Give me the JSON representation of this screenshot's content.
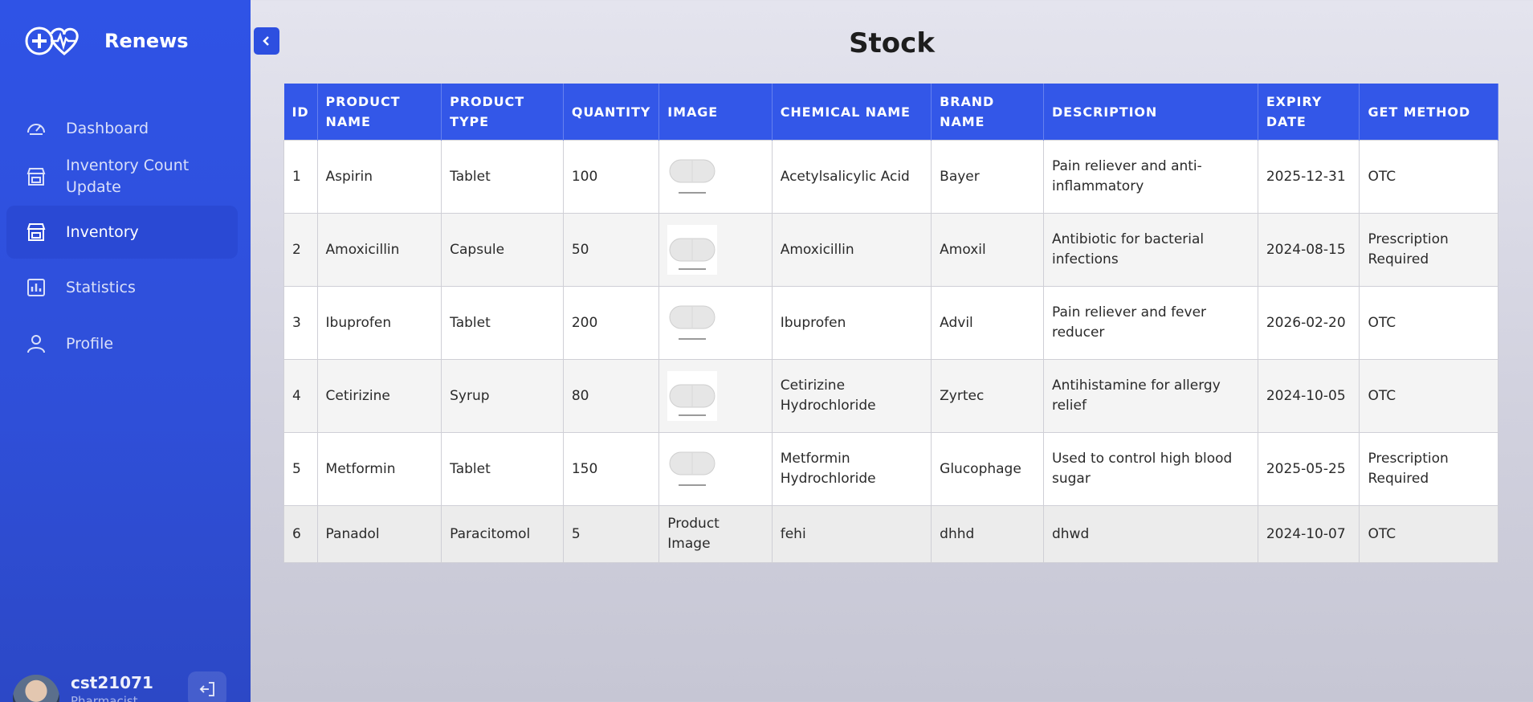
{
  "app": {
    "name": "Renews"
  },
  "nav": [
    {
      "label": "Dashboard",
      "icon": "gauge-icon"
    },
    {
      "label": "Inventory Count Update",
      "icon": "store-icon"
    },
    {
      "label": "Inventory",
      "icon": "store-icon",
      "active": true
    },
    {
      "label": "Statistics",
      "icon": "bar-chart-icon"
    },
    {
      "label": "Profile",
      "icon": "user-icon"
    }
  ],
  "user": {
    "name": "cst21071",
    "role": "Pharmacist"
  },
  "page": {
    "title": "Stock"
  },
  "table": {
    "columns": [
      "ID",
      "PRODUCT NAME",
      "PRODUCT TYPE",
      "QUANTITY",
      "IMAGE",
      "CHEMICAL NAME",
      "BRAND NAME",
      "DESCRIPTION",
      "EXPIRY DATE",
      "GET METHOD"
    ],
    "rows": [
      {
        "id": "1",
        "name": "Aspirin",
        "type": "Tablet",
        "qty": "100",
        "image": "pill-icon",
        "chemical": "Acetylsalicylic Acid",
        "brand": "Bayer",
        "desc": "Pain reliever and anti-inflammatory",
        "expiry": "2025-12-31",
        "method": "OTC"
      },
      {
        "id": "2",
        "name": "Amoxicillin",
        "type": "Capsule",
        "qty": "50",
        "image": "pill-icon",
        "chemical": "Amoxicillin",
        "brand": "Amoxil",
        "desc": "Antibiotic for bacterial infections",
        "expiry": "2024-08-15",
        "method": "Prescription Required"
      },
      {
        "id": "3",
        "name": "Ibuprofen",
        "type": "Tablet",
        "qty": "200",
        "image": "pill-icon",
        "chemical": "Ibuprofen",
        "brand": "Advil",
        "desc": "Pain reliever and fever reducer",
        "expiry": "2026-02-20",
        "method": "OTC"
      },
      {
        "id": "4",
        "name": "Cetirizine",
        "type": "Syrup",
        "qty": "80",
        "image": "pill-icon",
        "chemical": "Cetirizine Hydrochloride",
        "brand": "Zyrtec",
        "desc": "Antihistamine for allergy relief",
        "expiry": "2024-10-05",
        "method": "OTC"
      },
      {
        "id": "5",
        "name": "Metformin",
        "type": "Tablet",
        "qty": "150",
        "image": "pill-icon",
        "chemical": "Metformin Hydrochloride",
        "brand": "Glucophage",
        "desc": "Used to control high blood sugar",
        "expiry": "2025-05-25",
        "method": "Prescription Required"
      },
      {
        "id": "6",
        "name": "Panadol",
        "type": "Paracitomol",
        "qty": "5",
        "image_alt": "Product Image",
        "chemical": "fehi",
        "brand": "dhhd",
        "desc": "dhwd",
        "expiry": "2024-10-07",
        "method": "OTC"
      }
    ]
  },
  "colors": {
    "sidebar": "#2f53e6",
    "header": "#3357e8",
    "active_nav": "#2a49d4"
  }
}
